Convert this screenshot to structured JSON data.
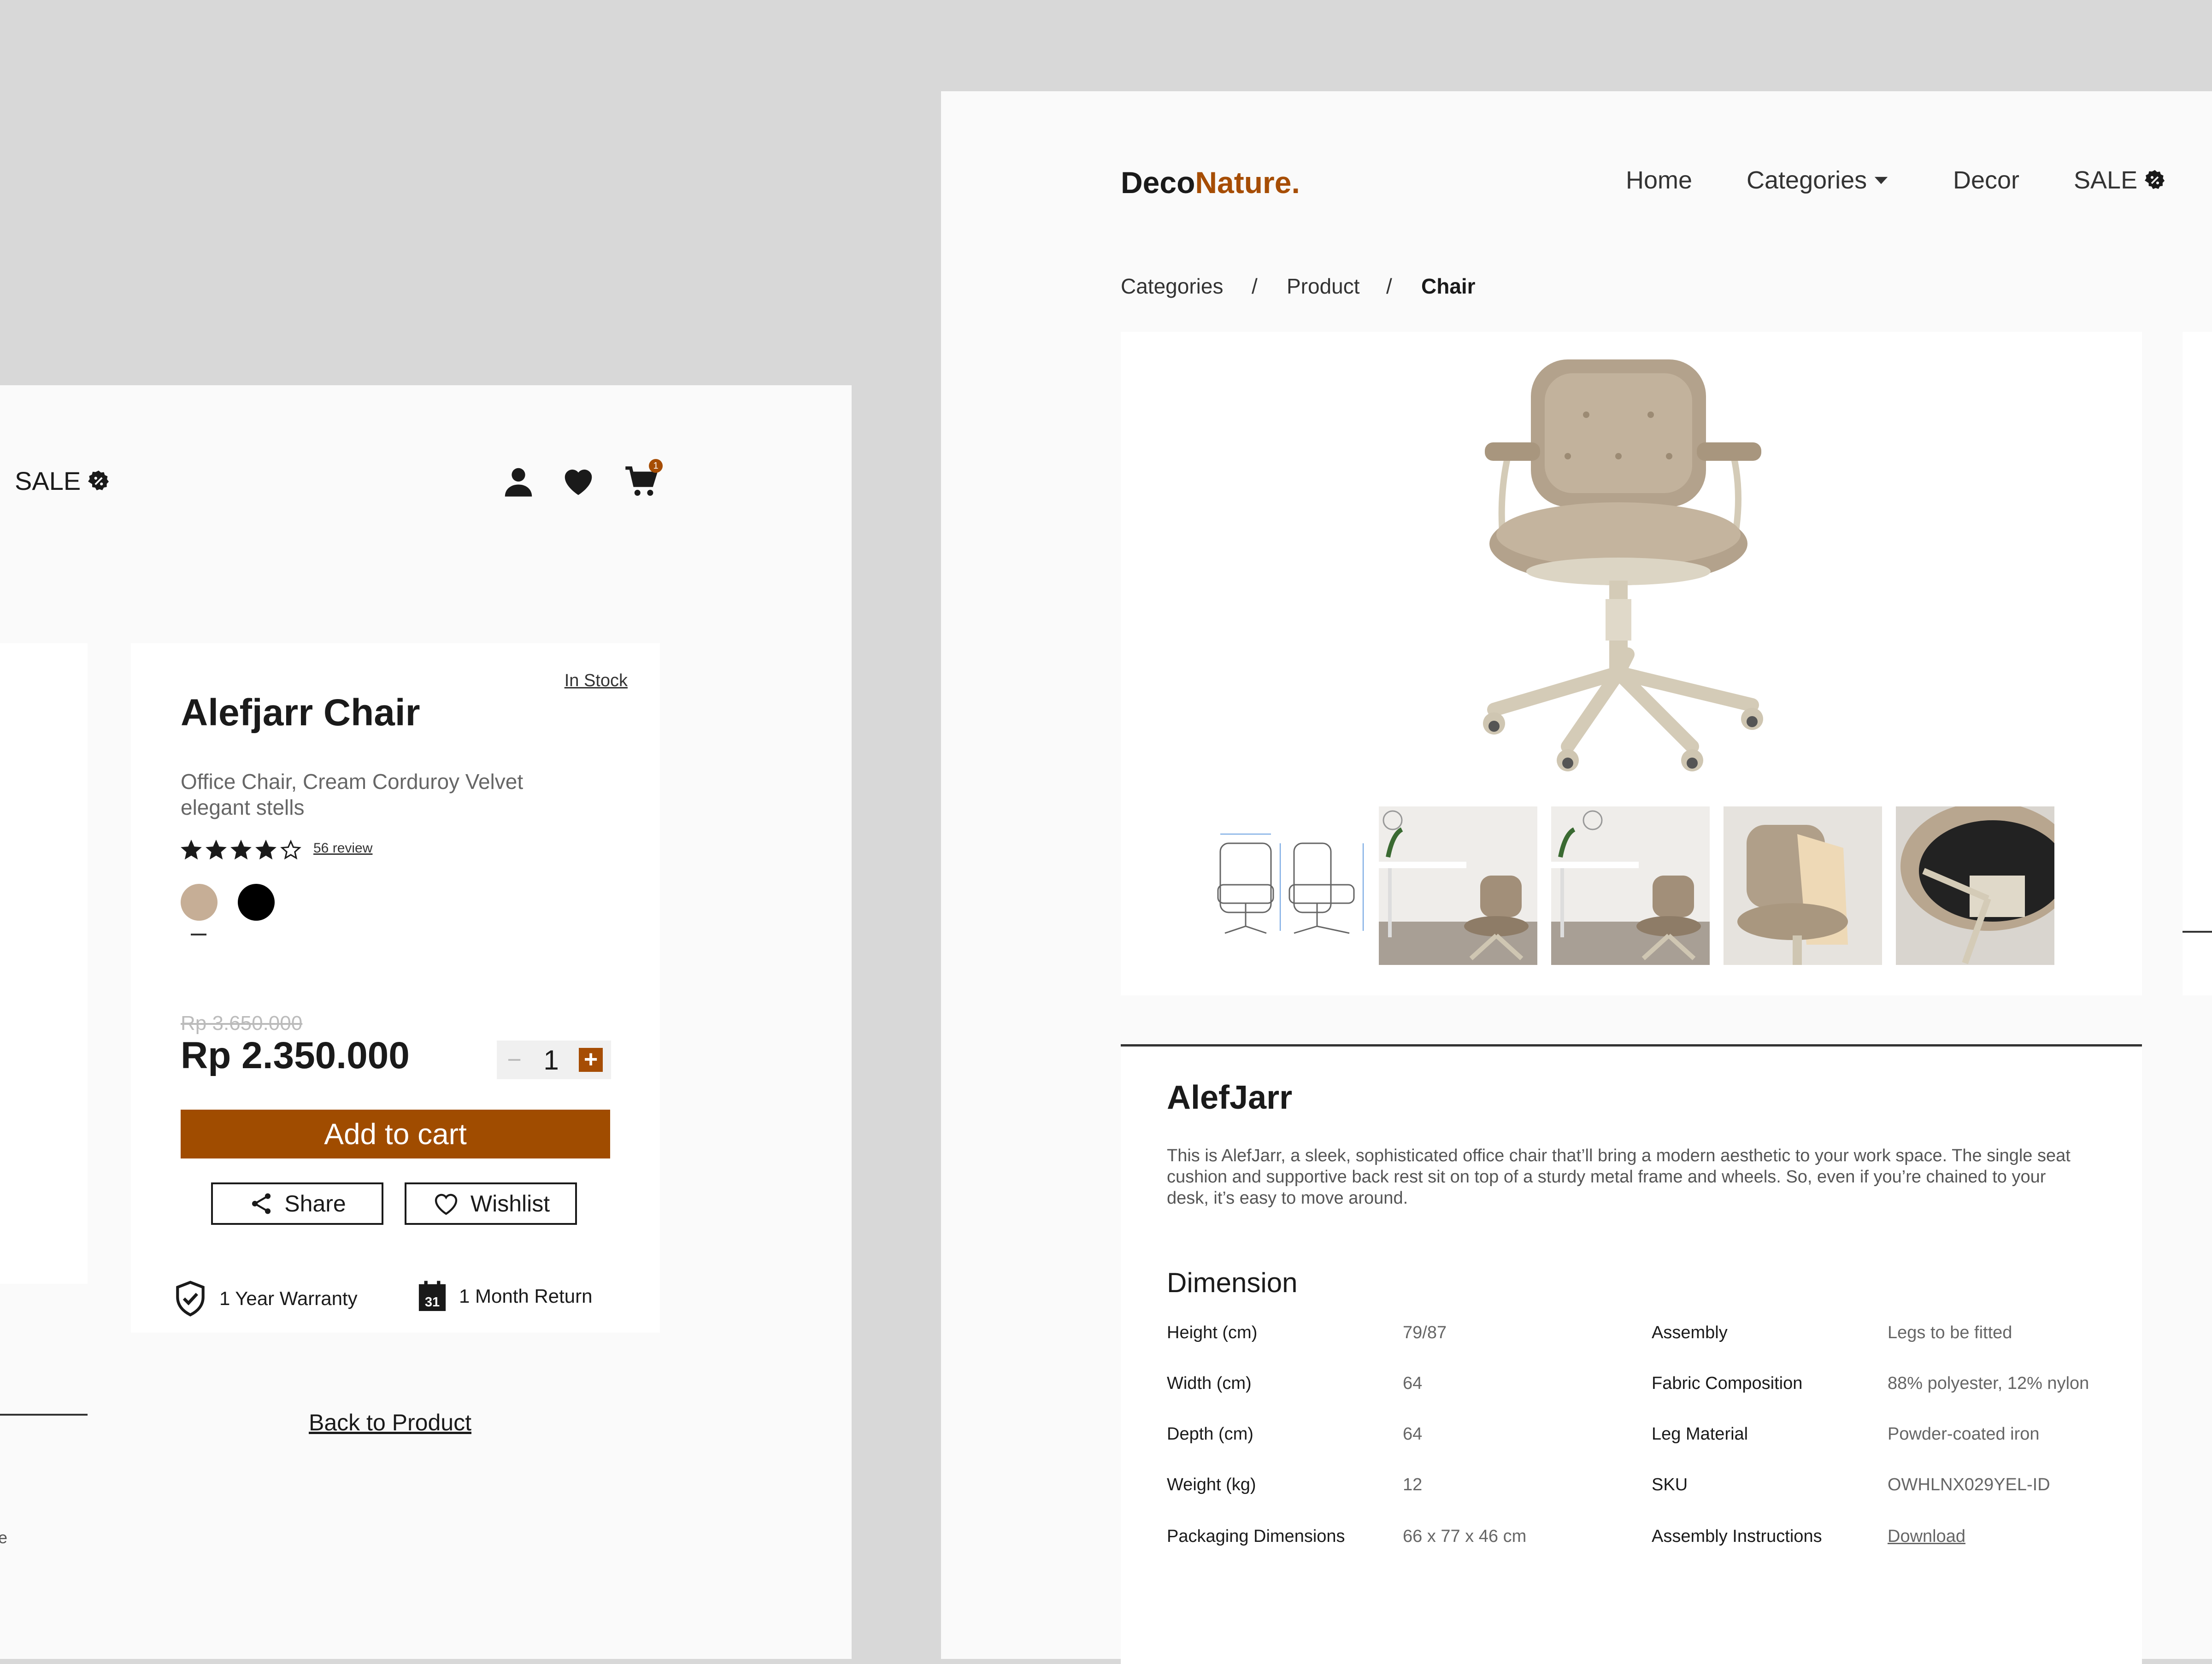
{
  "left": {
    "sale_label": "SALE",
    "cart_count": "1",
    "stub_text": "e",
    "product": {
      "stock_status": "In Stock",
      "title": "Alefjarr Chair",
      "subtitle": "Office Chair, Cream Corduroy Velvet elegant stells",
      "rating": 4,
      "rating_max": 5,
      "review_link": "56 review",
      "colors": [
        "#c6ae96",
        "#000000"
      ],
      "selected_color_index": 0,
      "old_price": "Rp 3.650.000",
      "price": "Rp 2.350.000",
      "quantity": "1",
      "minus_symbol": "−",
      "plus_symbol": "+",
      "add_to_cart_label": "Add to cart",
      "share_label": "Share",
      "wishlist_label": "Wishlist"
    },
    "features": {
      "warranty": "1 Year Warranty",
      "return": "1 Month Return",
      "calendar_day": "31"
    },
    "back_link": "Back to Product"
  },
  "right": {
    "logo": {
      "part1": "Deco",
      "part2": "Nature."
    },
    "nav": {
      "home": "Home",
      "categories": "Categories",
      "decor": "Decor",
      "sale": "SALE"
    },
    "breadcrumb": [
      "Categories",
      "Product",
      "Chair"
    ],
    "breadcrumb_sep": "/",
    "product_name": "AlefJarr",
    "description": "This is AlefJarr, a sleek, sophisticated office chair that’ll bring a modern aesthetic to your work space. The single seat cushion and supportive back rest sit on top of a sturdy metal frame and wheels. So, even if you’re chained to your desk, it’s easy to move around.",
    "dimension_title": "Dimension",
    "specs_left": [
      {
        "label": "Height (cm)",
        "value": "79/87"
      },
      {
        "label": "Width (cm)",
        "value": "64"
      },
      {
        "label": "Depth (cm)",
        "value": "64"
      },
      {
        "label": "Weight (kg)",
        "value": "12"
      },
      {
        "label": "Packaging Dimensions",
        "value": "66 x 77 x 46 cm"
      }
    ],
    "specs_right": [
      {
        "label": "Assembly",
        "value": "Legs to be fitted"
      },
      {
        "label": "Fabric Composition",
        "value": "88% polyester, 12% nylon"
      },
      {
        "label": "Leg Material",
        "value": "Powder-coated iron"
      },
      {
        "label": "SKU",
        "value": "OWHLNX029YEL-ID"
      },
      {
        "label": "Assembly Instructions",
        "value": "Download"
      }
    ]
  },
  "colors": {
    "accent": "#a64d04",
    "background": "#d8d8d8",
    "panel": "#fafafa"
  }
}
